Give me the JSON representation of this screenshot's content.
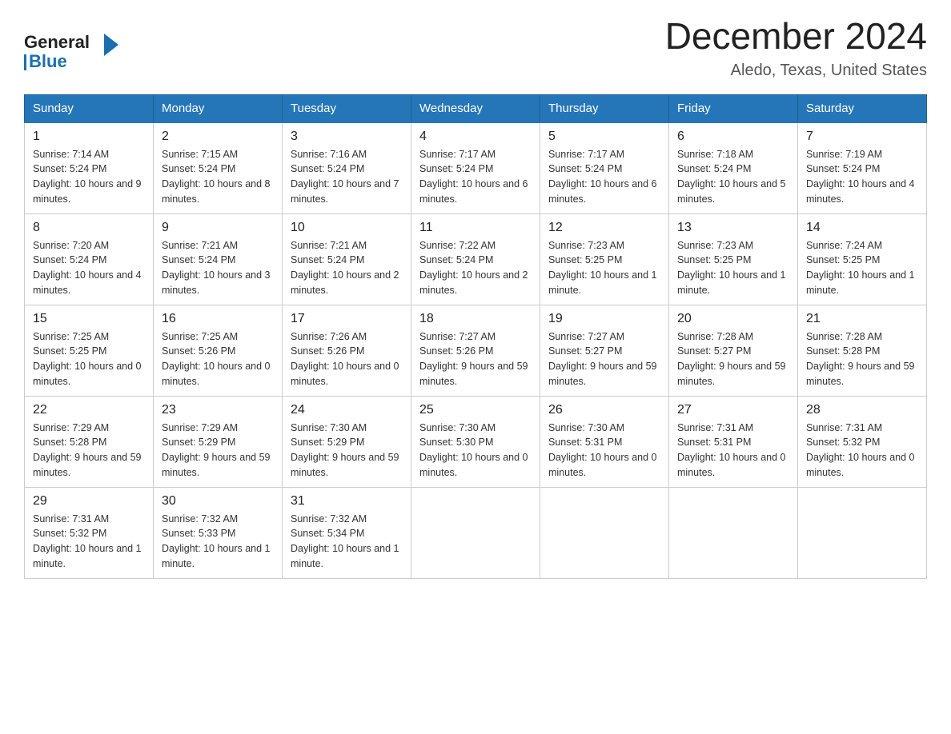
{
  "logo": {
    "general": "General",
    "blue": "Blue"
  },
  "title": "December 2024",
  "subtitle": "Aledo, Texas, United States",
  "days_header": [
    "Sunday",
    "Monday",
    "Tuesday",
    "Wednesday",
    "Thursday",
    "Friday",
    "Saturday"
  ],
  "weeks": [
    [
      {
        "num": "1",
        "sunrise": "7:14 AM",
        "sunset": "5:24 PM",
        "daylight": "10 hours and 9 minutes."
      },
      {
        "num": "2",
        "sunrise": "7:15 AM",
        "sunset": "5:24 PM",
        "daylight": "10 hours and 8 minutes."
      },
      {
        "num": "3",
        "sunrise": "7:16 AM",
        "sunset": "5:24 PM",
        "daylight": "10 hours and 7 minutes."
      },
      {
        "num": "4",
        "sunrise": "7:17 AM",
        "sunset": "5:24 PM",
        "daylight": "10 hours and 6 minutes."
      },
      {
        "num": "5",
        "sunrise": "7:17 AM",
        "sunset": "5:24 PM",
        "daylight": "10 hours and 6 minutes."
      },
      {
        "num": "6",
        "sunrise": "7:18 AM",
        "sunset": "5:24 PM",
        "daylight": "10 hours and 5 minutes."
      },
      {
        "num": "7",
        "sunrise": "7:19 AM",
        "sunset": "5:24 PM",
        "daylight": "10 hours and 4 minutes."
      }
    ],
    [
      {
        "num": "8",
        "sunrise": "7:20 AM",
        "sunset": "5:24 PM",
        "daylight": "10 hours and 4 minutes."
      },
      {
        "num": "9",
        "sunrise": "7:21 AM",
        "sunset": "5:24 PM",
        "daylight": "10 hours and 3 minutes."
      },
      {
        "num": "10",
        "sunrise": "7:21 AM",
        "sunset": "5:24 PM",
        "daylight": "10 hours and 2 minutes."
      },
      {
        "num": "11",
        "sunrise": "7:22 AM",
        "sunset": "5:24 PM",
        "daylight": "10 hours and 2 minutes."
      },
      {
        "num": "12",
        "sunrise": "7:23 AM",
        "sunset": "5:25 PM",
        "daylight": "10 hours and 1 minute."
      },
      {
        "num": "13",
        "sunrise": "7:23 AM",
        "sunset": "5:25 PM",
        "daylight": "10 hours and 1 minute."
      },
      {
        "num": "14",
        "sunrise": "7:24 AM",
        "sunset": "5:25 PM",
        "daylight": "10 hours and 1 minute."
      }
    ],
    [
      {
        "num": "15",
        "sunrise": "7:25 AM",
        "sunset": "5:25 PM",
        "daylight": "10 hours and 0 minutes."
      },
      {
        "num": "16",
        "sunrise": "7:25 AM",
        "sunset": "5:26 PM",
        "daylight": "10 hours and 0 minutes."
      },
      {
        "num": "17",
        "sunrise": "7:26 AM",
        "sunset": "5:26 PM",
        "daylight": "10 hours and 0 minutes."
      },
      {
        "num": "18",
        "sunrise": "7:27 AM",
        "sunset": "5:26 PM",
        "daylight": "9 hours and 59 minutes."
      },
      {
        "num": "19",
        "sunrise": "7:27 AM",
        "sunset": "5:27 PM",
        "daylight": "9 hours and 59 minutes."
      },
      {
        "num": "20",
        "sunrise": "7:28 AM",
        "sunset": "5:27 PM",
        "daylight": "9 hours and 59 minutes."
      },
      {
        "num": "21",
        "sunrise": "7:28 AM",
        "sunset": "5:28 PM",
        "daylight": "9 hours and 59 minutes."
      }
    ],
    [
      {
        "num": "22",
        "sunrise": "7:29 AM",
        "sunset": "5:28 PM",
        "daylight": "9 hours and 59 minutes."
      },
      {
        "num": "23",
        "sunrise": "7:29 AM",
        "sunset": "5:29 PM",
        "daylight": "9 hours and 59 minutes."
      },
      {
        "num": "24",
        "sunrise": "7:30 AM",
        "sunset": "5:29 PM",
        "daylight": "9 hours and 59 minutes."
      },
      {
        "num": "25",
        "sunrise": "7:30 AM",
        "sunset": "5:30 PM",
        "daylight": "10 hours and 0 minutes."
      },
      {
        "num": "26",
        "sunrise": "7:30 AM",
        "sunset": "5:31 PM",
        "daylight": "10 hours and 0 minutes."
      },
      {
        "num": "27",
        "sunrise": "7:31 AM",
        "sunset": "5:31 PM",
        "daylight": "10 hours and 0 minutes."
      },
      {
        "num": "28",
        "sunrise": "7:31 AM",
        "sunset": "5:32 PM",
        "daylight": "10 hours and 0 minutes."
      }
    ],
    [
      {
        "num": "29",
        "sunrise": "7:31 AM",
        "sunset": "5:32 PM",
        "daylight": "10 hours and 1 minute."
      },
      {
        "num": "30",
        "sunrise": "7:32 AM",
        "sunset": "5:33 PM",
        "daylight": "10 hours and 1 minute."
      },
      {
        "num": "31",
        "sunrise": "7:32 AM",
        "sunset": "5:34 PM",
        "daylight": "10 hours and 1 minute."
      },
      null,
      null,
      null,
      null
    ]
  ]
}
